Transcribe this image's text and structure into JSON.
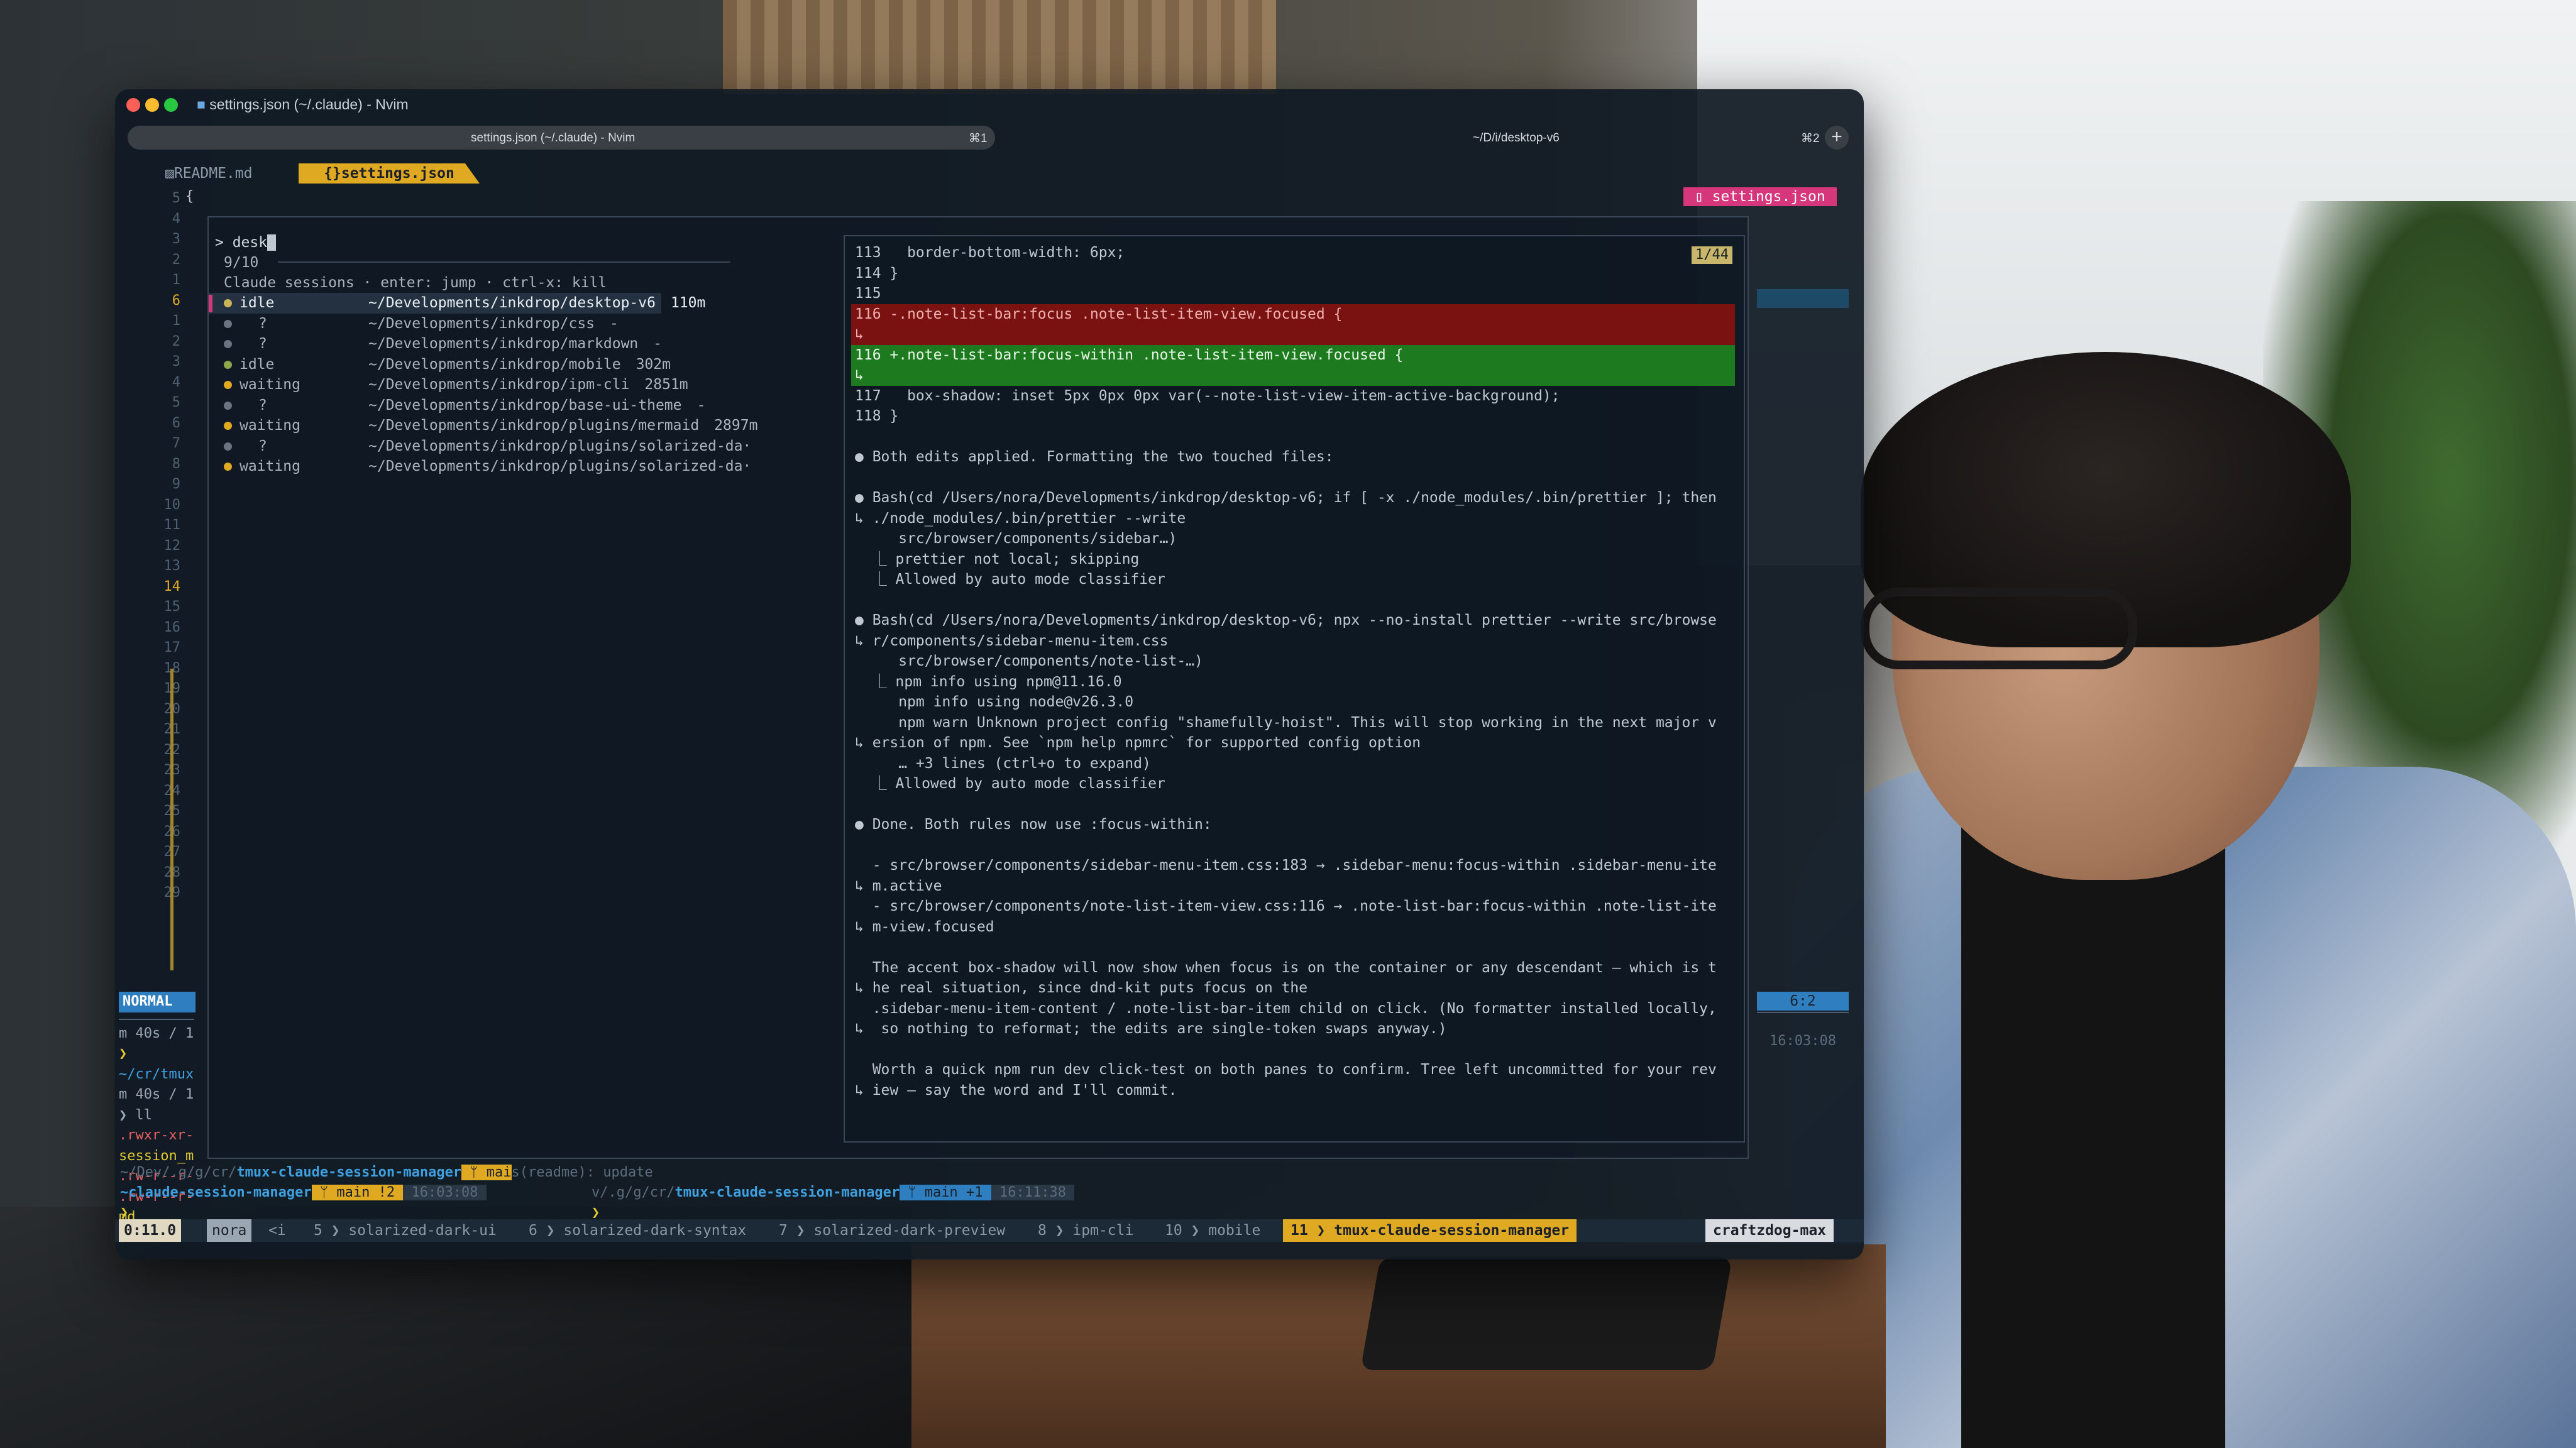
{
  "window": {
    "title": "settings.json (~/.claude) - Nvim",
    "tabs": [
      {
        "label": "settings.json (~/.claude) - Nvim",
        "shortcut": "⌘1"
      },
      {
        "label": "~/D/i/desktop-v6",
        "shortcut": "⌘2"
      }
    ],
    "new_tab": "+"
  },
  "buffers": [
    {
      "icon": "readme-icon",
      "label": "README.md"
    },
    {
      "icon": "braces-icon",
      "label": "settings.json",
      "active": true
    }
  ],
  "right_badge": "settings.json",
  "line_numbers": [
    "5",
    "4",
    "3",
    "2",
    "1",
    "6",
    "1",
    "2",
    "3",
    "4",
    "5",
    "6",
    "7",
    "8",
    "9",
    "10",
    "11",
    "12",
    "13",
    "14",
    "15",
    "16",
    "17",
    "18",
    "19",
    "20",
    "21",
    "22",
    "23",
    "24",
    "25",
    "26",
    "27",
    "28",
    "29"
  ],
  "first_code_line": "{",
  "picker": {
    "prompt": "> desk",
    "count": "9/10",
    "header": "Claude sessions · enter: jump · ctrl-x: kill",
    "rows": [
      {
        "status": "idle",
        "path": "~/Developments/inkdrop/desktop-v6",
        "time": "110m",
        "dot": "#c8b45a",
        "selected": true
      },
      {
        "status": "?",
        "path": "~/Developments/inkdrop/css",
        "time": "-",
        "dot": "#6a7480"
      },
      {
        "status": "?",
        "path": "~/Developments/inkdrop/markdown",
        "time": "-",
        "dot": "#6a7480"
      },
      {
        "status": "idle",
        "path": "~/Developments/inkdrop/mobile",
        "time": "302m",
        "dot": "#8aa84a"
      },
      {
        "status": "waiting",
        "path": "~/Developments/inkdrop/ipm-cli",
        "time": "2851m",
        "dot": "#e0a922"
      },
      {
        "status": "?",
        "path": "~/Developments/inkdrop/base-ui-theme",
        "time": "-",
        "dot": "#6a7480"
      },
      {
        "status": "waiting",
        "path": "~/Developments/inkdrop/plugins/mermaid",
        "time": "2897m",
        "dot": "#e0a922"
      },
      {
        "status": "?",
        "path": "~/Developments/inkdrop/plugins/solarized-da·",
        "time": "",
        "dot": "#6a7480"
      },
      {
        "status": "waiting",
        "path": "~/Developments/inkdrop/plugins/solarized-da·",
        "time": "",
        "dot": "#e0a922"
      }
    ]
  },
  "preview": {
    "counter": "1/44",
    "lines": [
      {
        "text": "113   border-bottom-width: 6px;"
      },
      {
        "text": "114 }"
      },
      {
        "text": "115"
      },
      {
        "text": "116 -.note-list-bar:focus .note-list-item-view.focused {",
        "kind": "del"
      },
      {
        "text": "↳",
        "kind": "del"
      },
      {
        "text": "116 +.note-list-bar:focus-within .note-list-item-view.focused {",
        "kind": "add"
      },
      {
        "text": "↳",
        "kind": "add"
      },
      {
        "text": "117   box-shadow: inset 5px 0px 0px var(--note-list-view-item-active-background);"
      },
      {
        "text": "118 }"
      },
      {
        "text": ""
      },
      {
        "text": "● Both edits applied. Formatting the two touched files:"
      },
      {
        "text": ""
      },
      {
        "text": "● Bash(cd /Users/nora/Developments/inkdrop/desktop-v6; if [ -x ./node_modules/.bin/prettier ]; then"
      },
      {
        "text": "↳ ./node_modules/.bin/prettier --write"
      },
      {
        "text": "     src/browser/components/sidebar…)"
      },
      {
        "text": "  ⎿ prettier not local; skipping"
      },
      {
        "text": "  ⎿ Allowed by auto mode classifier"
      },
      {
        "text": ""
      },
      {
        "text": "● Bash(cd /Users/nora/Developments/inkdrop/desktop-v6; npx --no-install prettier --write src/browse"
      },
      {
        "text": "↳ r/components/sidebar-menu-item.css"
      },
      {
        "text": "     src/browser/components/note-list-…)"
      },
      {
        "text": "  ⎿ npm info using npm@11.16.0"
      },
      {
        "text": "     npm info using node@v26.3.0"
      },
      {
        "text": "     npm warn Unknown project config \"shamefully-hoist\". This will stop working in the next major v"
      },
      {
        "text": "↳ ersion of npm. See `npm help npmrc` for supported config option"
      },
      {
        "text": "     … +3 lines (ctrl+o to expand)"
      },
      {
        "text": "  ⎿ Allowed by auto mode classifier"
      },
      {
        "text": ""
      },
      {
        "text": "● Done. Both rules now use :focus-within:"
      },
      {
        "text": ""
      },
      {
        "text": "  - src/browser/components/sidebar-menu-item.css:183 → .sidebar-menu:focus-within .sidebar-menu-ite"
      },
      {
        "text": "↳ m.active"
      },
      {
        "text": "  - src/browser/components/note-list-item-view.css:116 → .note-list-bar:focus-within .note-list-ite"
      },
      {
        "text": "↳ m-view.focused"
      },
      {
        "text": ""
      },
      {
        "text": "  The accent box-shadow will now show when focus is on the container or any descendant — which is t"
      },
      {
        "text": "↳ he real situation, since dnd-kit puts focus on the"
      },
      {
        "text": "  .sidebar-menu-item-content / .note-list-bar-item child on click. (No formatter installed locally,"
      },
      {
        "text": "↳  so nothing to reformat; the edits are single-token swaps anyway.)"
      },
      {
        "text": ""
      },
      {
        "text": "  Worth a quick npm run dev click-test on both panes to confirm. Tree left uncommitted for your rev"
      },
      {
        "text": "↳ iew — say the word and I'll commit."
      }
    ]
  },
  "left_pane": {
    "mode": "NORMAL",
    "lines": [
      "m 40s / 1",
      "❯",
      "~/cr/tmux",
      "m 40s / 1",
      "❯ ll",
      ".rwxr-xr-",
      "session_m",
      ".rw-r--r-",
      ".rw-r--r-",
      "md",
      "drwxr-xr-"
    ]
  },
  "right_side": {
    "position": "6:2",
    "time": "16:03:08"
  },
  "shell": {
    "line1_path": "~/Dev/.g/g/cr/tmux-claude-session-manager",
    "line1_branch": "mai",
    "line1_msg": "s(readme): update",
    "line2_left": "~claude-session-manager",
    "line2_branch": "main !2",
    "line2_time": "16:03:08",
    "line2_path": "v/.g/g/cr/tmux-claude-session-manager",
    "line2_branch2": "main +1",
    "line2_time2": "16:11:38",
    "prompt": "❯"
  },
  "tmux": {
    "session": "0:11.0",
    "user": "nora",
    "left_trunc": "<i",
    "windows": [
      {
        "num": "5",
        "name": "solarized-dark-ui"
      },
      {
        "num": "6",
        "name": "solarized-dark-syntax"
      },
      {
        "num": "7",
        "name": "solarized-dark-preview"
      },
      {
        "num": "8",
        "name": "ipm-cli"
      },
      {
        "num": "10",
        "name": "mobile"
      },
      {
        "num": "11",
        "name": "tmux-claude-session-manager",
        "active": true
      }
    ],
    "host": "craftzdog-max"
  }
}
